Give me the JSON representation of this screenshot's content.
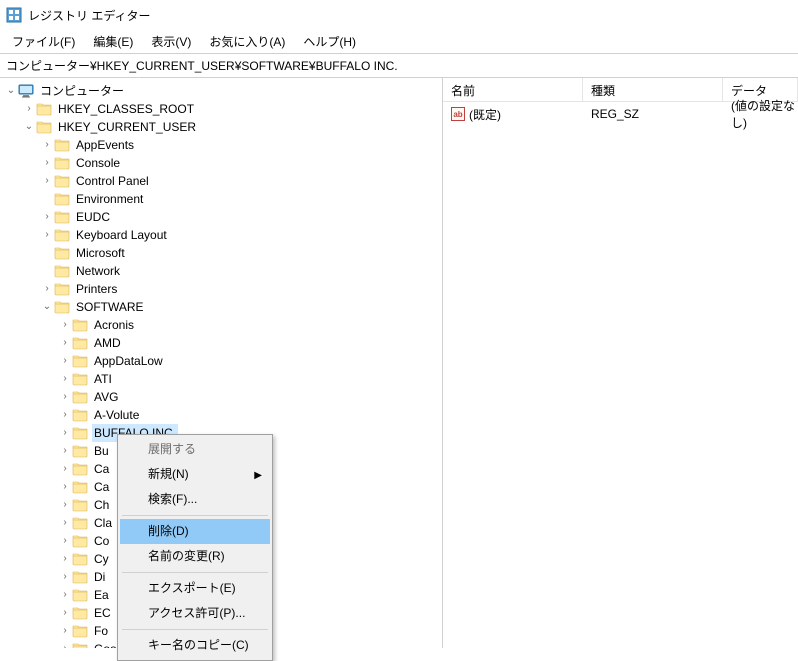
{
  "title": "レジストリ エディター",
  "menu": {
    "file": "ファイル(F)",
    "edit": "編集(E)",
    "view": "表示(V)",
    "fav": "お気に入り(A)",
    "help": "ヘルプ(H)"
  },
  "address": "コンピューター¥HKEY_CURRENT_USER¥SOFTWARE¥BUFFALO INC.",
  "list_header": {
    "name": "名前",
    "type": "種類",
    "data": "データ"
  },
  "values": [
    {
      "name": "(既定)",
      "type": "REG_SZ",
      "data": "(値の設定なし)"
    }
  ],
  "tree": {
    "root": "コンピューター",
    "hives": {
      "classes": "HKEY_CLASSES_ROOT",
      "cu": "HKEY_CURRENT_USER"
    },
    "cu_children": {
      "appevents": "AppEvents",
      "console": "Console",
      "cp": "Control Panel",
      "env": "Environment",
      "eudc": "EUDC",
      "keyb": "Keyboard Layout",
      "ms": "Microsoft",
      "net": "Network",
      "printers": "Printers",
      "software": "SOFTWARE"
    },
    "software_children": {
      "acronis": "Acronis",
      "amd": "AMD",
      "appdatalow": "AppDataLow",
      "ati": "ATI",
      "avg": "AVG",
      "avolute": "A-Volute",
      "buffalo": "BUFFALO INC.",
      "bu": "Bu",
      "ca1": "Ca",
      "ca2": "Ca",
      "ch": "Ch",
      "cla": "Cla",
      "co": "Co",
      "cy": "Cy",
      "di": "Di",
      "ea": "Ea",
      "ec": "EC",
      "fo": "Fo",
      "google": "Google"
    }
  },
  "context": {
    "expand": "展開する",
    "new": "新規(N)",
    "find": "検索(F)...",
    "delete": "削除(D)",
    "rename": "名前の変更(R)",
    "export": "エクスポート(E)",
    "perm": "アクセス許可(P)...",
    "copyname": "キー名のコピー(C)"
  }
}
